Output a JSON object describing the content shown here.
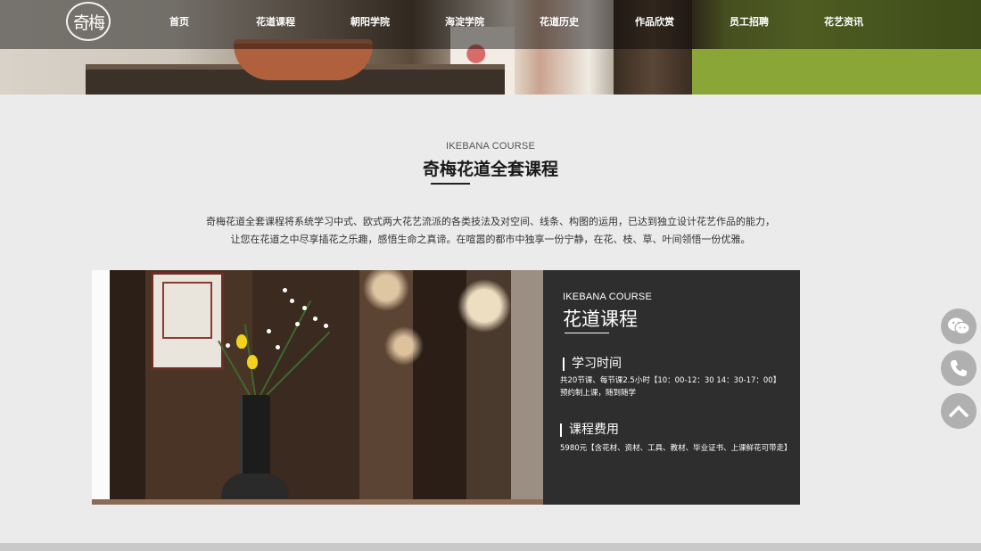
{
  "header": {
    "logo_text": "奇梅",
    "nav": [
      "首页",
      "花道课程",
      "朝阳学院",
      "海淀学院",
      "花道历史",
      "作品欣赏",
      "员工招聘",
      "花艺资讯"
    ]
  },
  "intro": {
    "subtitle_en": "IKEBANA COURSE",
    "title": "奇梅花道全套课程",
    "paragraph_line1": "奇梅花道全套课程将系统学习中式、欧式两大花艺流派的各类技法及对空间、线条、构图的运用，已达到独立设计花艺作品的能力，",
    "paragraph_line2": "让您在花道之中尽享插花之乐趣，感悟生命之真谛。在喧嚣的都市中独享一份宁静，在花、枝、草、叶间领悟一份优雅。"
  },
  "course_card": {
    "subtitle_en": "IKEBANA COURSE",
    "title": "花道课程",
    "study_time": {
      "heading": "学习时间",
      "line1": "共20节课、每节课2.5小时【10：00-12：30 14：30-17：00】",
      "line2": "预约制上课，随到随学"
    },
    "fee": {
      "heading": "课程费用",
      "line1": "5980元【含花材、资材、工具、教材、毕业证书、上课鲜花可带走】"
    }
  },
  "side_widgets": [
    "wechat-icon",
    "phone-icon",
    "back-to-top-icon"
  ],
  "colors": {
    "page_bg": "#ebebeb",
    "card_bg": "#2e2e2e",
    "widget_bg": "#b0b0b0"
  }
}
